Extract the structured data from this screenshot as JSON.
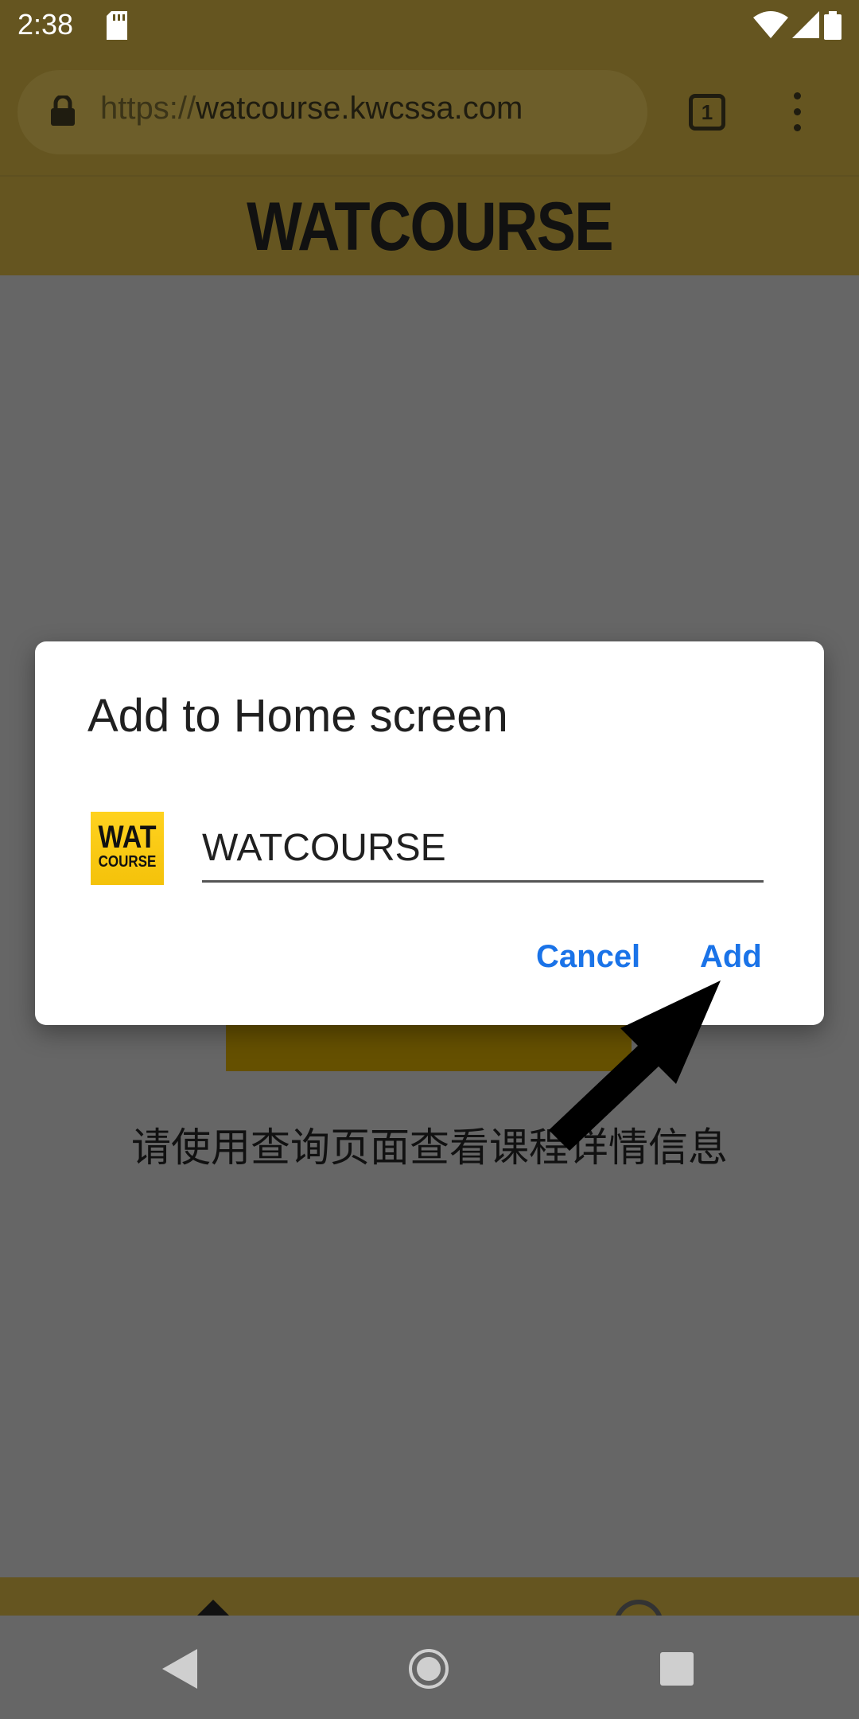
{
  "status_bar": {
    "time": "2:38",
    "icons": [
      "sd-card-icon",
      "wifi-icon",
      "signal-icon",
      "battery-icon"
    ]
  },
  "browser": {
    "url_scheme": "https://",
    "url_host": "watcourse.kwcssa.com",
    "tab_count": "1"
  },
  "page": {
    "site_title": "WATCOURSE",
    "body_text": "请使用查询页面查看课程详情信息"
  },
  "dialog": {
    "title": "Add to Home screen",
    "icon_line1": "WAT",
    "icon_line2": "COURSE",
    "name_value": "WATCOURSE",
    "cancel_label": "Cancel",
    "add_label": "Add"
  },
  "colors": {
    "toolbar_bg": "#655520",
    "accent": "#1a73e8",
    "icon_yellow": "#ffd21f"
  }
}
